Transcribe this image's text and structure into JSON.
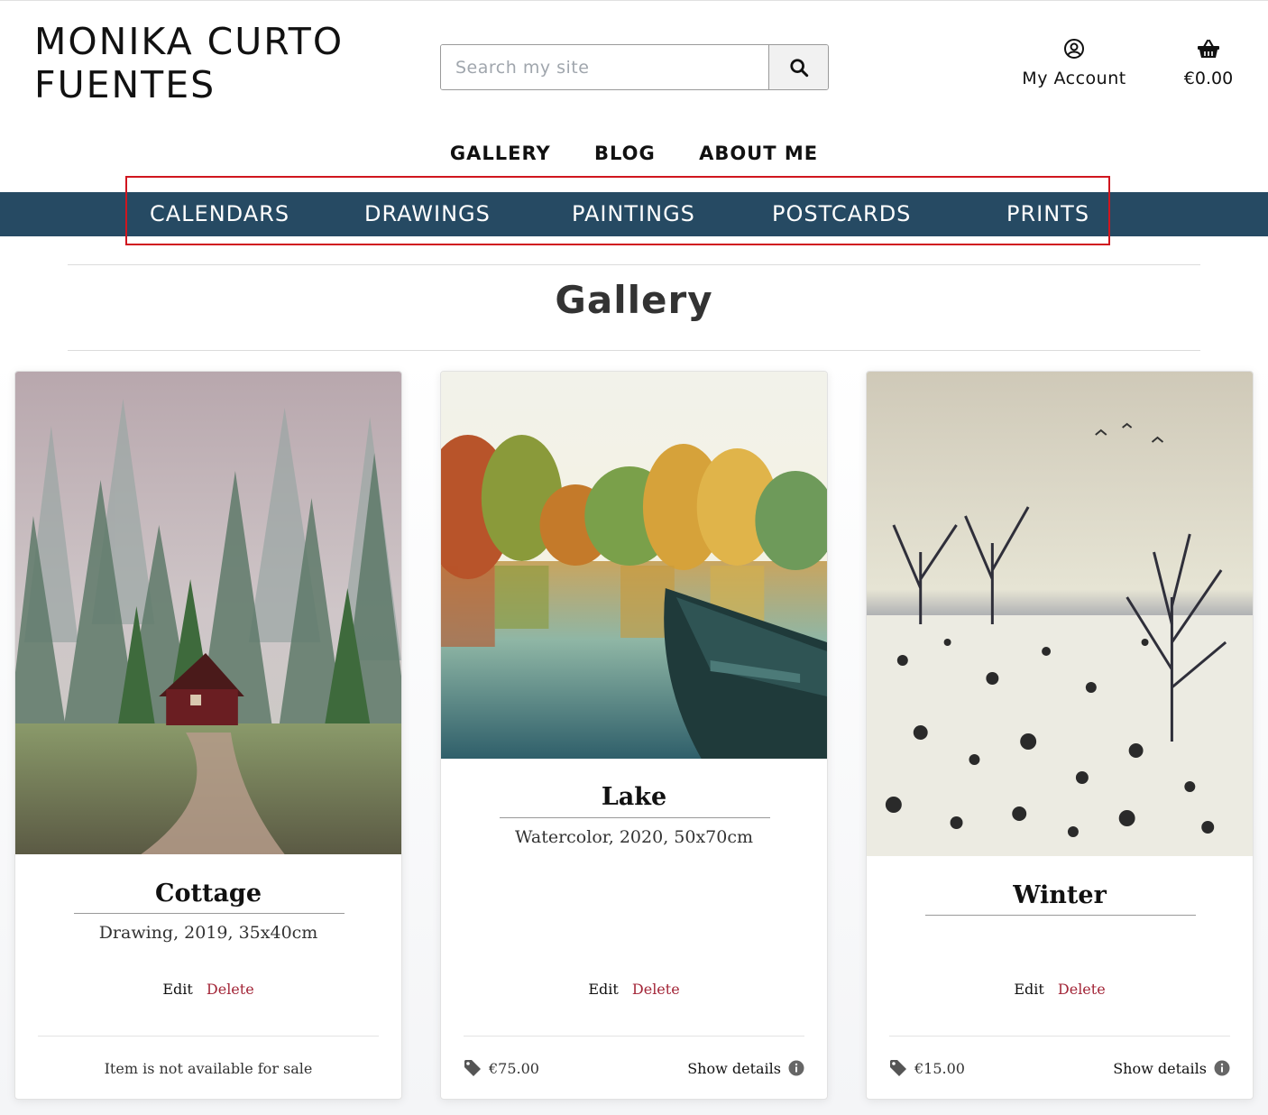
{
  "brand": {
    "line1": "MONIKA CURTO",
    "line2": "FUENTES"
  },
  "search": {
    "placeholder": "Search my site"
  },
  "header": {
    "account_label": "My Account",
    "basket_total": "€0.00"
  },
  "main_nav": [
    "GALLERY",
    "BLOG",
    "ABOUT ME"
  ],
  "category_nav": [
    "CALENDARS",
    "DRAWINGS",
    "PAINTINGS",
    "POSTCARDS",
    "PRINTS"
  ],
  "page": {
    "title": "Gallery"
  },
  "cards": [
    {
      "title": "Cottage",
      "description": "Drawing, 2019, 35x40cm",
      "edit": "Edit",
      "delete": "Delete",
      "availability": "Item is not available for sale"
    },
    {
      "title": "Lake",
      "description": "Watercolor, 2020, 50x70cm",
      "edit": "Edit",
      "delete": "Delete",
      "price": "€75.00",
      "details": "Show details"
    },
    {
      "title": "Winter",
      "description": "",
      "edit": "Edit",
      "delete": "Delete",
      "price": "€15.00",
      "details": "Show details"
    }
  ],
  "colors": {
    "category_bar": "#264a63",
    "delete_link": "#a32638",
    "highlight_box": "#d0161f"
  }
}
